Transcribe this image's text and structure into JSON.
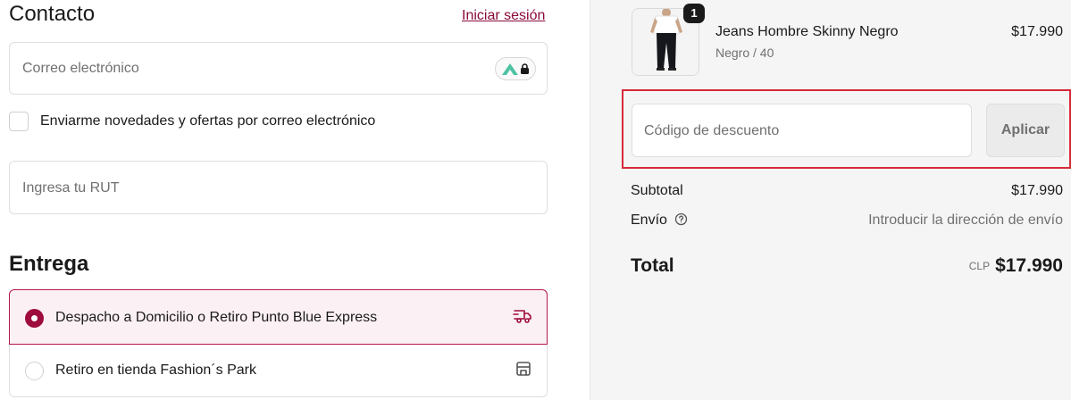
{
  "contact": {
    "heading": "Contacto",
    "login_link": "Iniciar sesión",
    "email_placeholder": "Correo electrónico",
    "newsletter_label": "Enviarme novedades y ofertas por correo electrónico",
    "newsletter_checked": false,
    "rut_placeholder": "Ingresa tu RUT"
  },
  "delivery": {
    "heading": "Entrega",
    "options": [
      {
        "label": "Despacho a Domicilio o Retiro Punto Blue Express",
        "selected": true,
        "icon": "truck-icon"
      },
      {
        "label": "Retiro en tienda Fashion´s Park",
        "selected": false,
        "icon": "store-icon"
      }
    ]
  },
  "cart": {
    "item": {
      "quantity": "1",
      "name": "Jeans Hombre Skinny Negro",
      "variant": "Negro / 40",
      "price": "$17.990"
    },
    "discount": {
      "placeholder": "Código de descuento",
      "apply_label": "Aplicar"
    },
    "subtotal_label": "Subtotal",
    "subtotal_value": "$17.990",
    "shipping_label": "Envío",
    "shipping_value": "Introducir la dirección de envío",
    "total_label": "Total",
    "total_currency": "CLP",
    "total_value": "$17.990"
  },
  "colors": {
    "accent": "#9e0b3d",
    "highlight_border": "#d62a39",
    "summary_bg": "#f5f5f5"
  }
}
